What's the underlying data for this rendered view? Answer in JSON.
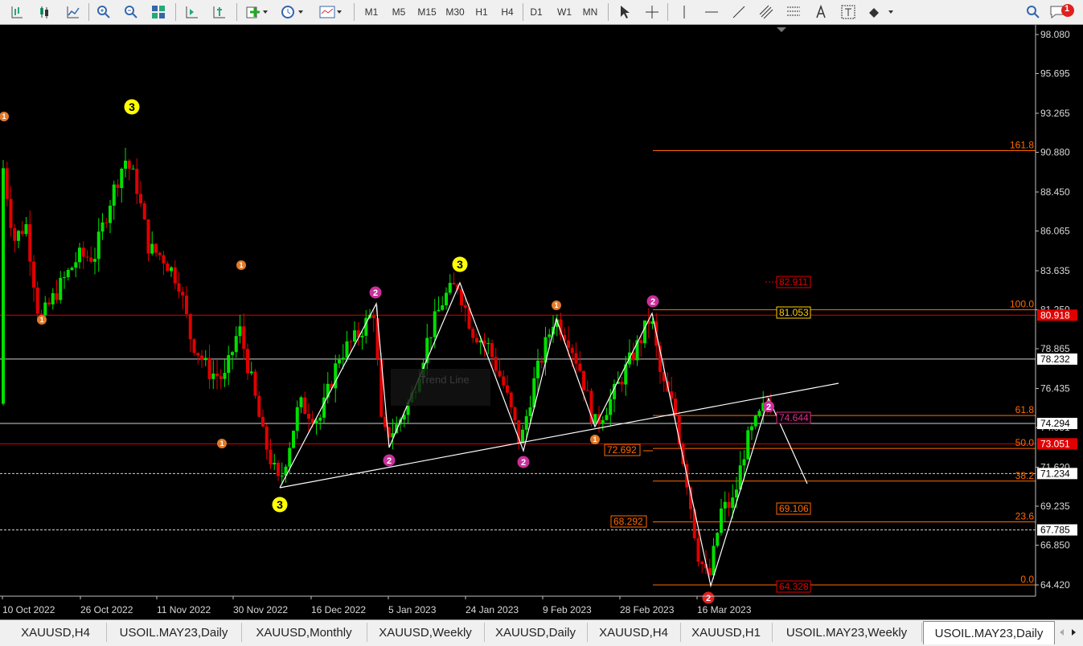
{
  "toolbar": {
    "timeframes": [
      "M1",
      "M5",
      "M15",
      "M30",
      "H1",
      "H4",
      "D1",
      "W1",
      "MN"
    ],
    "notification_count": "1"
  },
  "price_axis": {
    "labels": [
      "98.080",
      "95.695",
      "93.265",
      "90.880",
      "88.450",
      "86.065",
      "83.635",
      "81.250",
      "78.865",
      "76.435",
      "74.051",
      "71.620",
      "69.235",
      "66.850",
      "64.420"
    ],
    "tags": [
      {
        "text": "80.918",
        "bg": "#e00000",
        "fg": "#ffffff"
      },
      {
        "text": "78.232",
        "bg": "#ffffff",
        "fg": "#000000"
      },
      {
        "text": "74.294",
        "bg": "#ffffff",
        "fg": "#000000"
      },
      {
        "text": "73.051",
        "bg": "#e00000",
        "fg": "#ffffff"
      },
      {
        "text": "71.234",
        "bg": "#ffffff",
        "fg": "#000000"
      },
      {
        "text": "67.785",
        "bg": "#ffffff",
        "fg": "#000000"
      }
    ]
  },
  "time_axis": [
    "10 Oct 2022",
    "26 Oct 2022",
    "11 Nov 2022",
    "30 Nov 2022",
    "16 Dec 2022",
    "5 Jan 2023",
    "24 Jan 2023",
    "9 Feb 2023",
    "28 Feb 2023",
    "16 Mar 2023"
  ],
  "fib_labels": [
    "161.8",
    "100.0",
    "61.8",
    "50.0",
    "38.2",
    "23.6",
    "0.0"
  ],
  "boxed_labels": {
    "l82911": "82.911",
    "l81053": "81.053",
    "l74644": "74.644",
    "l72692": "72.692",
    "l69106": "69.106",
    "l68292": "68.292",
    "l64328": "64.328"
  },
  "wave_markers": [
    "3",
    "3",
    "3",
    "2",
    "2",
    "2",
    "2",
    "2",
    "2",
    "1",
    "1",
    "1",
    "1",
    "1",
    "1"
  ],
  "ghost_label": "Trend Line",
  "tabs": [
    "XAUUSD,H4",
    "USOIL.MAY23,Daily",
    "XAUUSD,Monthly",
    "XAUUSD,Weekly",
    "XAUUSD,Daily",
    "XAUUSD,H4",
    "XAUUSD,H1",
    "USOIL.MAY23,Weekly",
    "USOIL.MAY23,Daily"
  ],
  "colors": {
    "bull": "#00e000",
    "bear": "#e00000",
    "fib": "#ff6a00",
    "wave_yellow": "#ffff00",
    "wave_magenta": "#c8309a",
    "wave_orange": "#e07a2a"
  }
}
